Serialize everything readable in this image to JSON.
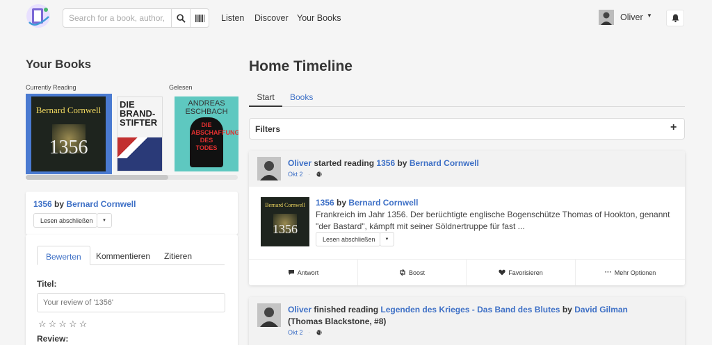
{
  "navbar": {
    "search_placeholder": "Search for a book, author, u",
    "links": [
      "Listen",
      "Discover",
      "Your Books"
    ],
    "user_name": "Oliver"
  },
  "left": {
    "title": "Your Books",
    "shelf_labels": [
      "Currently Reading",
      "Gelesen"
    ],
    "covers": [
      {
        "author": "Bernard Cornwell",
        "title": "1356",
        "color": "#1e241e"
      },
      {
        "title": "DIE BRAND-STIFTER",
        "color": "#f4f4f4"
      },
      {
        "author": "ANDREAS ESCHBACH",
        "title": "DIE ABSCHAFFUNG DES TODES",
        "color": "#5ec8c0"
      }
    ],
    "book": {
      "title": "1356",
      "by": "by",
      "author": "Bernard Cornwell",
      "button": "Lesen abschließen"
    },
    "tabs": [
      "Bewerten",
      "Kommentieren",
      "Zitieren"
    ],
    "title_label": "Titel:",
    "review_placeholder": "Your review of '1356'",
    "review_label": "Review:"
  },
  "timeline": {
    "title": "Home Timeline",
    "tabs": [
      "Start",
      "Books"
    ],
    "filters_label": "Filters",
    "posts": [
      {
        "user": "Oliver",
        "action": "started reading",
        "book": "1356",
        "by": "by",
        "author": "Bernard Cornwell",
        "date": "Okt 2",
        "body_book": "1356",
        "body_author": "Bernard Cornwell",
        "body_text": "Frankreich im Jahr 1356. Der berüchtigte englische Bogenschütze Thomas of Hookton, genannt \"der Bastard\", kämpft mit seiner Söldnertruppe für fast ...",
        "button": "Lesen abschließen",
        "actions": [
          "Antwort",
          "Boost",
          "Favorisieren",
          "Mehr Optionen"
        ]
      },
      {
        "user": "Oliver",
        "action": "finished reading",
        "book": "Legenden des Krieges - Das Band des Blutes",
        "by": "by",
        "author": "David Gilman",
        "series": "(Thomas Blackstone, #8)",
        "date": "Okt 2"
      }
    ]
  },
  "colors": {
    "link": "#3e70c6",
    "selected_cover": "#4a7ad1"
  }
}
